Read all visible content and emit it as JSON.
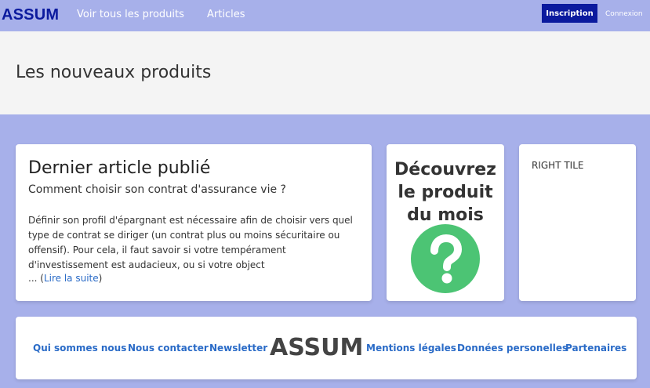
{
  "navbar": {
    "brand": "ASSUM",
    "links": [
      "Voir tous les produits",
      "Articles"
    ],
    "signup_label": "Inscription",
    "login_label": "Connexion"
  },
  "hero": {
    "title": "Les nouveaux produits"
  },
  "article_card": {
    "heading": "Dernier article publié",
    "subtitle": "Comment choisir son contrat d'assurance vie ?",
    "body": "Définir son profil d'épargnant est nécessaire afin de choisir vers quel type de contrat se diriger (un contrat plus ou moins sécuritaire ou offensif). Pour cela, il faut savoir si votre tempérament d'investissement est audacieux, ou si votre object",
    "ellipsis": "... (",
    "read_more": "Lire la suite",
    "close_paren": ")"
  },
  "product_card": {
    "title": "Découvrez le produit du mois",
    "icon": "question-mark-circle-icon",
    "icon_color": "#4cc474"
  },
  "right_tile": {
    "label": "RIGHT TILE"
  },
  "footer": {
    "links_left": [
      "Qui sommes nous",
      "Nous contacter",
      "Newsletter"
    ],
    "logo": "ASSUM",
    "links_right": [
      "Mentions légales",
      "Données personelles",
      "Partenaires"
    ]
  },
  "colors": {
    "background": "#a7b0ea",
    "brand": "#0b1a9e",
    "link": "#2a6bc7",
    "hero_bg": "#f4f4f4"
  }
}
